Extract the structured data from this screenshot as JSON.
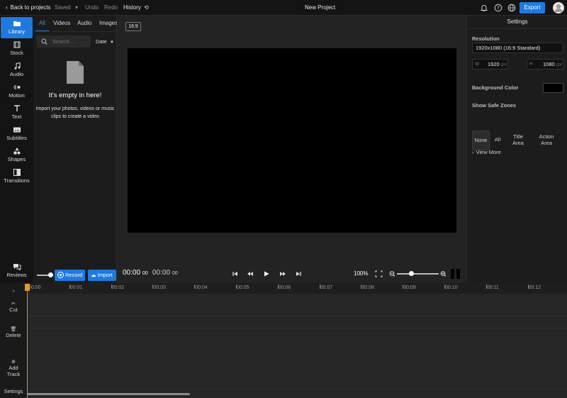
{
  "topbar": {
    "back_label": "Back to projects",
    "saved_label": "Saved",
    "undo_label": "Undo",
    "redo_label": "Redo",
    "history_label": "History",
    "project_title": "New Project",
    "export_label": "Export"
  },
  "nav": [
    {
      "label": "Library",
      "icon": "folder-icon"
    },
    {
      "label": "Stock",
      "icon": "film-icon"
    },
    {
      "label": "Audio",
      "icon": "music-note-icon"
    },
    {
      "label": "Motion",
      "icon": "motion-icon"
    },
    {
      "label": "Text",
      "icon": "text-icon"
    },
    {
      "label": "Subtitles",
      "icon": "subtitles-icon"
    },
    {
      "label": "Shapes",
      "icon": "shapes-icon"
    },
    {
      "label": "Transitions",
      "icon": "transitions-icon"
    },
    {
      "label": "Reviews",
      "icon": "chat-icon"
    }
  ],
  "library": {
    "tabs": [
      "All",
      "Videos",
      "Audio",
      "Images"
    ],
    "search_placeholder": "Search...",
    "sort_label": "Date",
    "empty_title": "It's empty in here!",
    "empty_line1": "Import your photos, videos or music",
    "empty_line2": "clips to create a video",
    "record_label": "Record",
    "import_label": "Import"
  },
  "preview": {
    "aspect": "16:9",
    "current_time": "00:00",
    "current_frames": "00",
    "total_time": "00:00",
    "total_frames": "00",
    "zoom": "100%"
  },
  "settings": {
    "title": "Settings",
    "resolution_label": "Resolution",
    "resolution_value": "1920x1080 (16:9 Standard)",
    "width_prefix": "W",
    "width_value": "1920",
    "height_prefix": "H",
    "height_value": "1080",
    "unit": "px",
    "bg_color_label": "Background Color",
    "bg_color": "#000000",
    "safe_zones_label": "Show Safe Zones",
    "zones": [
      "None",
      "All",
      "Title Area",
      "Action Area"
    ],
    "view_more": "View More"
  },
  "timeline": {
    "ticks": [
      "00:00",
      "00:01",
      "00:02",
      "00:03",
      "00:04",
      "00:05",
      "00:06",
      "00:07",
      "00:08",
      "00:09",
      "00:10",
      "00:11",
      "00:12"
    ],
    "cut_label": "Cut",
    "delete_label": "Delete",
    "add_track_line1": "Add",
    "add_track_line2": "Track",
    "settings_label": "Settings"
  },
  "colors": {
    "accent": "#1f7ae0",
    "playhead": "#d98a1c"
  }
}
